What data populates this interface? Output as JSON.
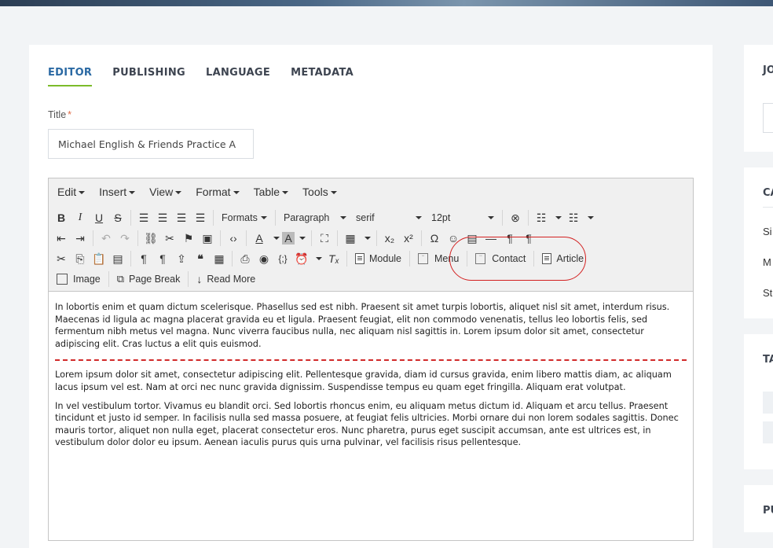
{
  "tabs": [
    {
      "label": "EDITOR",
      "active": true
    },
    {
      "label": "PUBLISHING",
      "active": false
    },
    {
      "label": "LANGUAGE",
      "active": false
    },
    {
      "label": "METADATA",
      "active": false
    }
  ],
  "title_field": {
    "label": "Title",
    "required_mark": "*",
    "value": "Michael English & Friends Practice A"
  },
  "menubar": [
    "Edit",
    "Insert",
    "View",
    "Format",
    "Table",
    "Tools"
  ],
  "toolbar": {
    "formats": "Formats",
    "paragraph": "Paragraph",
    "font": "serif",
    "size": "12pt",
    "module": "Module",
    "menu": "Menu",
    "contact": "Contact",
    "article": "Article",
    "image": "Image",
    "page_break": "Page Break",
    "read_more": "Read More"
  },
  "content": {
    "p1": "In lobortis enim et quam dictum scelerisque. Phasellus sed est nibh. Praesent sit amet turpis lobortis, aliquet nisl sit amet, interdum risus. Maecenas id ligula ac magna placerat gravida eu et ligula. Praesent feugiat, elit non commodo venenatis, tellus leo lobortis felis, sed fermentum nibh metus vel magna. Nunc viverra faucibus nulla, nec aliquam nisl sagittis in. Lorem ipsum dolor sit amet, consectetur adipiscing elit. Cras luctus a elit quis euismod.",
    "p2": "Lorem ipsum dolor sit amet, consectetur adipiscing elit. Pellentesque gravida, diam id cursus gravida, enim libero mattis diam, ac aliquam lacus ipsum vel est. Nam at orci nec nunc gravida dignissim. Suspendisse tempus eu quam eget fringilla. Aliquam erat volutpat.",
    "p3": "In vel vestibulum tortor. Vivamus eu blandit orci. Sed lobortis rhoncus enim, eu aliquam metus dictum id. Aliquam et arcu tellus. Praesent tincidunt et justo id semper. In facilisis nulla sed massa posuere, at feugiat felis ultricies. Morbi ornare dui non lorem sodales sagittis. Donec mauris tortor, aliquet non nulla eget, placerat consectetur eros. Nunc pharetra, purus eget suscipit accumsan, ante est ultrices est, in vestibulum dolor dolor eu ipsum. Aenean iaculis purus quis urna pulvinar, vel facilisis risus pellentesque."
  },
  "sidebar": {
    "card1_title": "JO",
    "card2_title": "CA",
    "card2_items": [
      "Si",
      "M",
      "St"
    ],
    "card3_title": "TA",
    "card4_title": "PU"
  },
  "colors": {
    "accent": "#2a69a3",
    "active_underline": "#7cbb2a",
    "highlight_oval": "#d32020",
    "page_break": "#d12a2a"
  }
}
